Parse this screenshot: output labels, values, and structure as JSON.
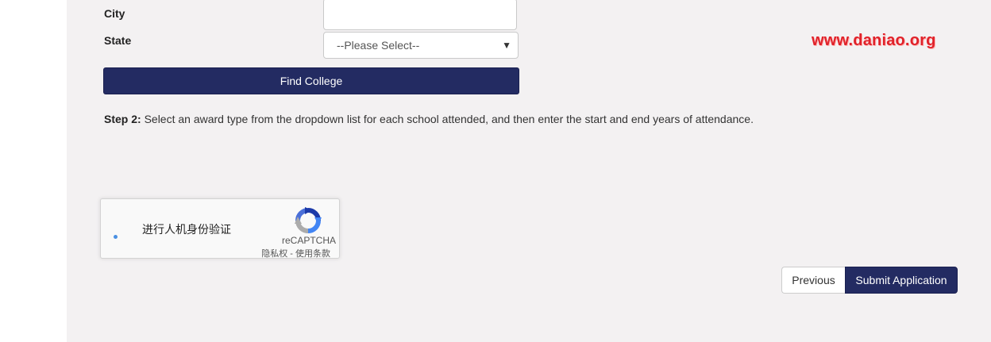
{
  "form": {
    "city_label": "City",
    "city_value": "",
    "state_label": "State",
    "state_selected": "--Please Select--",
    "find_college_label": "Find College"
  },
  "step2": {
    "prefix": "Step 2:",
    "text": " Select an award type from the dropdown list for each school attended, and then enter the start and end years of attendance."
  },
  "watermark": {
    "text": "www.daniao.org"
  },
  "recaptcha": {
    "label": "进行人机身份验证",
    "brand": "reCAPTCHA",
    "links": "隐私权 - 使用条款"
  },
  "navigation": {
    "previous_label": "Previous",
    "submit_label": "Submit Application"
  },
  "colors": {
    "primary": "#232b62",
    "page_background": "#f3f1f2",
    "watermark": "#e0222a"
  }
}
